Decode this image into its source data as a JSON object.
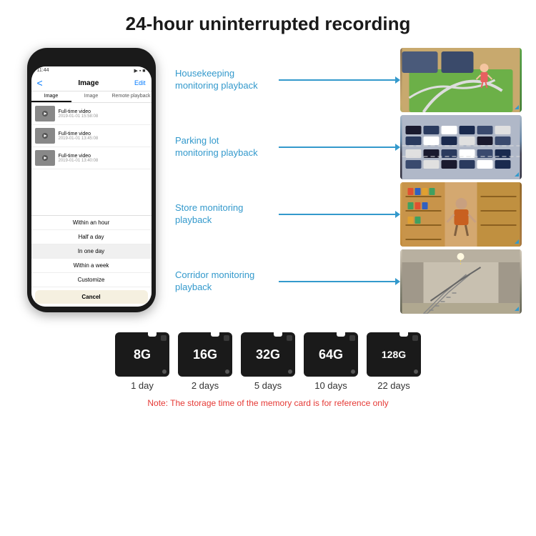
{
  "header": {
    "title": "24-hour uninterrupted recording"
  },
  "phone": {
    "time": "11:44",
    "screen_title": "Image",
    "back_label": "<",
    "edit_label": "Edit",
    "tabs": [
      "Image",
      "Image",
      "Remote playback"
    ],
    "videos": [
      {
        "title": "Full-time video",
        "time": "2019-01-01 15:58:08"
      },
      {
        "title": "Full-time video",
        "time": "2019-01-01 13:45:08"
      },
      {
        "title": "Full-time video",
        "time": "2019-01-01 13:40:08"
      }
    ],
    "dropdown_items": [
      "Within an hour",
      "Half a day",
      "In one day",
      "Within a week",
      "Customize"
    ],
    "cancel_label": "Cancel"
  },
  "monitoring": [
    {
      "label": "Housekeeping\nmonitoring playback",
      "scene": "housekeeping"
    },
    {
      "label": "Parking lot\nmonitoring playback",
      "scene": "parking"
    },
    {
      "label": "Store monitoring\nplayback",
      "scene": "store"
    },
    {
      "label": "Corridor monitoring\nplayback",
      "scene": "corridor"
    }
  ],
  "sd_cards": [
    {
      "size": "8G",
      "days": "1 day"
    },
    {
      "size": "16G",
      "days": "2 days"
    },
    {
      "size": "32G",
      "days": "5 days"
    },
    {
      "size": "64G",
      "days": "10 days"
    },
    {
      "size": "128G",
      "days": "22 days"
    }
  ],
  "note": "Note: The storage time of the memory card is for reference only"
}
